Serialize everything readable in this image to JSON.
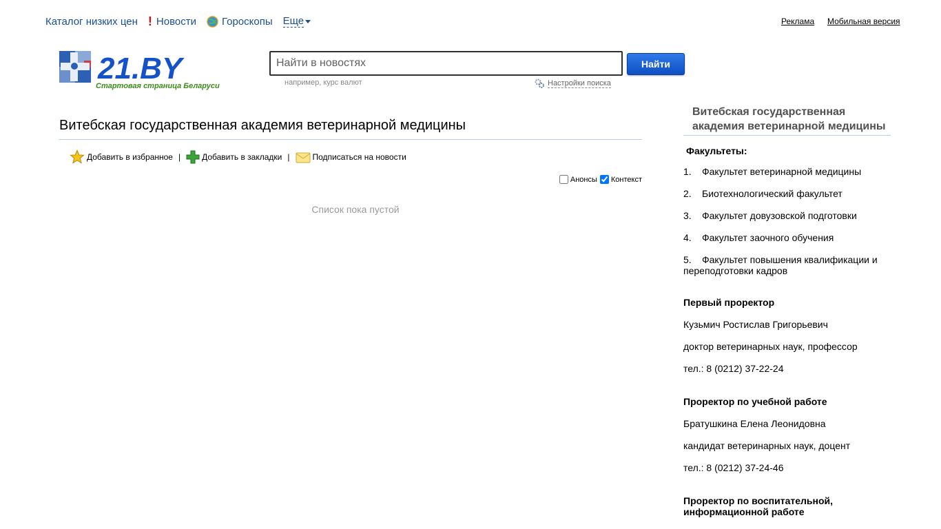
{
  "nav": {
    "items": [
      {
        "label": "Каталог низких цен"
      },
      {
        "label": "Новости"
      },
      {
        "label": "Гороскопы"
      },
      {
        "label": "Еще"
      }
    ],
    "right_links": [
      "Реклама",
      "Мобильная версия"
    ]
  },
  "logo": {
    "text": "21.BY",
    "subtitle": "Стартовая страница Беларуси"
  },
  "search": {
    "placeholder": "Найти в новостях",
    "button": "Найти",
    "hint": "например, курс валют",
    "settings": "Настройки поиска"
  },
  "main": {
    "title": "Витебская государственная академия ветеринарной медицины",
    "actions": [
      "Добавить в избранное",
      "Добавить в закладки",
      "Подписаться на новости"
    ],
    "filters": [
      {
        "label": "Анонсы",
        "checked": false
      },
      {
        "label": "Контекст",
        "checked": true
      }
    ],
    "empty_text": "Список пока пустой"
  },
  "sidebar": {
    "title": "Витебская государственная академия ветеринарной медицины",
    "faculties_heading": "Факультеты:",
    "faculties": [
      {
        "num": "1.",
        "name": "Факультет ветеринарной медицины"
      },
      {
        "num": "2.",
        "name": "Биотехнологический факультет"
      },
      {
        "num": "3.",
        "name": "Факультет довузовской подготовки"
      },
      {
        "num": "4.",
        "name": "Факультет заочного обучения"
      },
      {
        "num": "5.",
        "name": "Факультет повышения квалификации и переподготовки кадров"
      }
    ],
    "persons": [
      {
        "role": "Первый проректор",
        "name": "Кузьмич Ростислав Григорьевич",
        "degree": "доктор ветеринарных наук, профессор",
        "phone": "тел.: 8 (0212) 37-22-24"
      },
      {
        "role": "Проректор по учебной работе",
        "name": "Братушкина Елена Леонидовна",
        "degree": "кандидат ветеринарных наук, доцент",
        "phone": "тел.: 8 (0212) 37-24-46"
      },
      {
        "role": "Проректор по воспитательной, информационной работе"
      }
    ]
  },
  "colors": {
    "link": "#1a4f94",
    "button": "#1a5fd6",
    "logo_blue": "#1552c9",
    "logo_green": "#3e8a1d",
    "rule": "#b8cfe6"
  }
}
